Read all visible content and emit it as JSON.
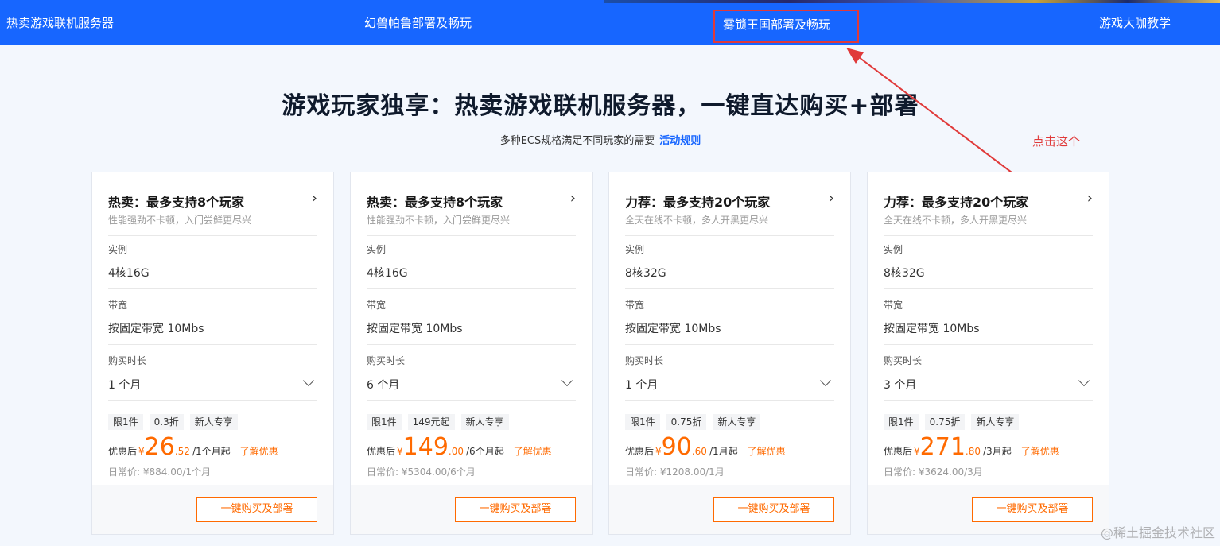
{
  "nav": {
    "items": [
      "热卖游戏联机服务器",
      "幻兽帕鲁部署及畅玩",
      "雾锁王国部署及畅玩",
      "游戏大咖教学"
    ]
  },
  "hero": {
    "title": "游戏玩家独享：热卖游戏联机服务器，一键直达购买+部署",
    "subtitle": "多种ECS规格满足不同玩家的需要",
    "rules_link": "活动规则"
  },
  "annotation": {
    "text": "点击这个",
    "color": "#e03a3a"
  },
  "labels": {
    "instance": "实例",
    "bandwidth": "带宽",
    "duration": "购买时长",
    "after_discount": "优惠后",
    "currency": "¥",
    "learn_more": "了解优惠",
    "buy_button": "一键购买及部署"
  },
  "cards": [
    {
      "title": "热卖：最多支持8个玩家",
      "desc": "性能强劲不卡顿，入门尝鲜更尽兴",
      "instance": "4核16G",
      "bandwidth": "按固定带宽 10Mbs",
      "duration": "1 个月",
      "tags": [
        "限1件",
        "0.3折",
        "新人专享"
      ],
      "price_int": "26",
      "price_dec": ".52",
      "price_unit": "/1个月起",
      "normal_price": "日常价: ¥884.00/1个月"
    },
    {
      "title": "热卖：最多支持8个玩家",
      "desc": "性能强劲不卡顿，入门尝鲜更尽兴",
      "instance": "4核16G",
      "bandwidth": "按固定带宽 10Mbs",
      "duration": "6 个月",
      "tags": [
        "限1件",
        "149元起",
        "新人专享"
      ],
      "price_int": "149",
      "price_dec": ".00",
      "price_unit": "/6个月起",
      "normal_price": "日常价: ¥5304.00/6个月"
    },
    {
      "title": "力荐：最多支持20个玩家",
      "desc": "全天在线不卡顿，多人开黑更尽兴",
      "instance": "8核32G",
      "bandwidth": "按固定带宽 10Mbs",
      "duration": "1 个月",
      "tags": [
        "限1件",
        "0.75折",
        "新人专享"
      ],
      "price_int": "90",
      "price_dec": ".60",
      "price_unit": "/1月起",
      "normal_price": "日常价: ¥1208.00/1月"
    },
    {
      "title": "力荐：最多支持20个玩家",
      "desc": "全天在线不卡顿，多人开黑更尽兴",
      "instance": "8核32G",
      "bandwidth": "按固定带宽 10Mbs",
      "duration": "3 个月",
      "tags": [
        "限1件",
        "0.75折",
        "新人专享"
      ],
      "price_int": "271",
      "price_dec": ".80",
      "price_unit": "/3月起",
      "normal_price": "日常价: ¥3624.00/3月"
    }
  ],
  "watermark": "@稀土掘金技术社区"
}
